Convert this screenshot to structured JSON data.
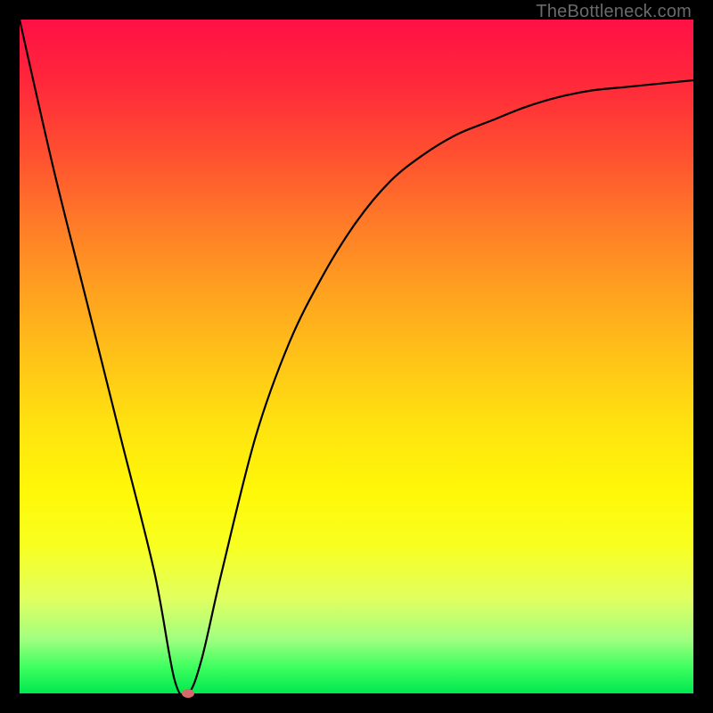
{
  "watermark": "TheBottleneck.com",
  "chart_data": {
    "type": "line",
    "title": "",
    "xlabel": "",
    "ylabel": "",
    "xlim": [
      0,
      100
    ],
    "ylim": [
      0,
      100
    ],
    "x": [
      0,
      5,
      10,
      15,
      20,
      23,
      25,
      27,
      30,
      35,
      40,
      45,
      50,
      55,
      60,
      65,
      70,
      75,
      80,
      85,
      90,
      95,
      100
    ],
    "values": [
      100,
      78,
      58,
      38,
      18,
      2,
      0,
      5,
      18,
      38,
      52,
      62,
      70,
      76,
      80,
      83,
      85,
      87,
      88.5,
      89.5,
      90,
      90.5,
      91
    ],
    "minimum_point": {
      "x": 25,
      "y": 0
    },
    "colors": {
      "gradient_top": "#ff1045",
      "gradient_bottom": "#00e850",
      "curve": "#000000",
      "dot": "#d46a6a",
      "frame": "#000000"
    }
  }
}
